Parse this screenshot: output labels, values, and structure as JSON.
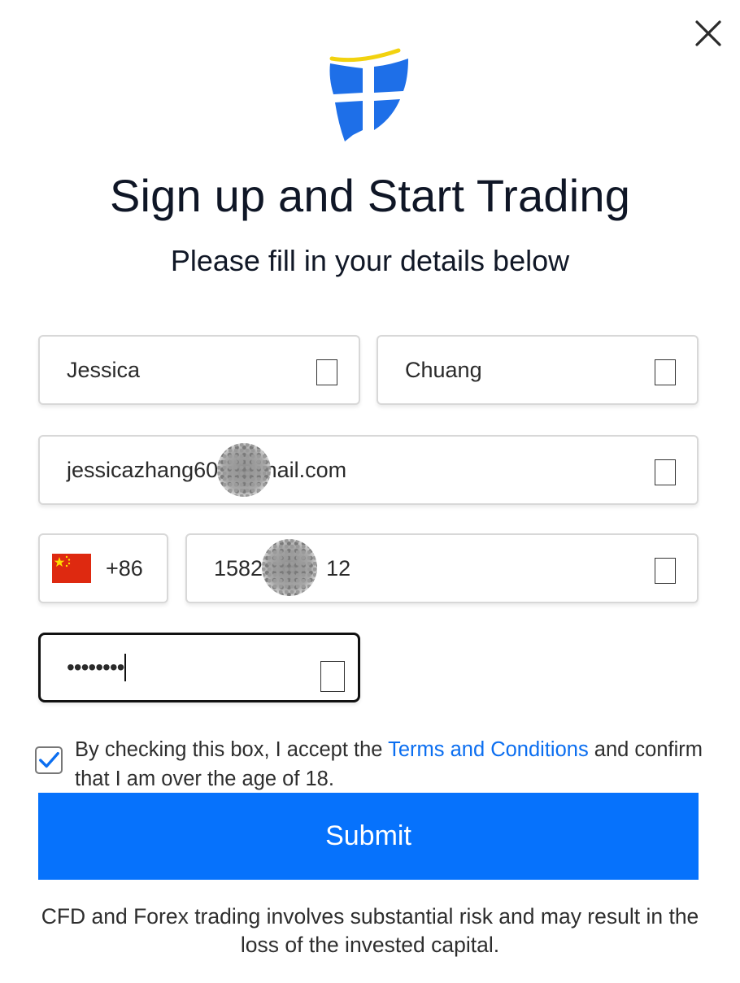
{
  "close": {
    "icon": "close-icon"
  },
  "logo": {
    "icon": "brand-logo",
    "colors": {
      "blue": "#1e6fe8",
      "yellow": "#f2d20f"
    }
  },
  "header": {
    "title": "Sign up and Start Trading",
    "subtitle": "Please fill in your details below"
  },
  "form": {
    "first_name": {
      "value": "Jessica"
    },
    "last_name": {
      "value": "Chuang"
    },
    "email": {
      "value_start": "jessicazhang60",
      "value_end": "mail.com"
    },
    "phone": {
      "country": "China",
      "flag_icon": "china-flag-icon",
      "code": "+86",
      "value_start": "1582",
      "value_end": "12"
    },
    "password": {
      "masked_value": "••••••••"
    }
  },
  "consent": {
    "checked": true,
    "text_before": "By checking this box, I accept the ",
    "link_text": "Terms and Conditions",
    "text_after": " and confirm that I am over the age of 18."
  },
  "submit": {
    "label": "Submit",
    "color": "#0672fc"
  },
  "disclaimer": "CFD and Forex trading involves substantial risk and may result in the loss of the invested capital."
}
